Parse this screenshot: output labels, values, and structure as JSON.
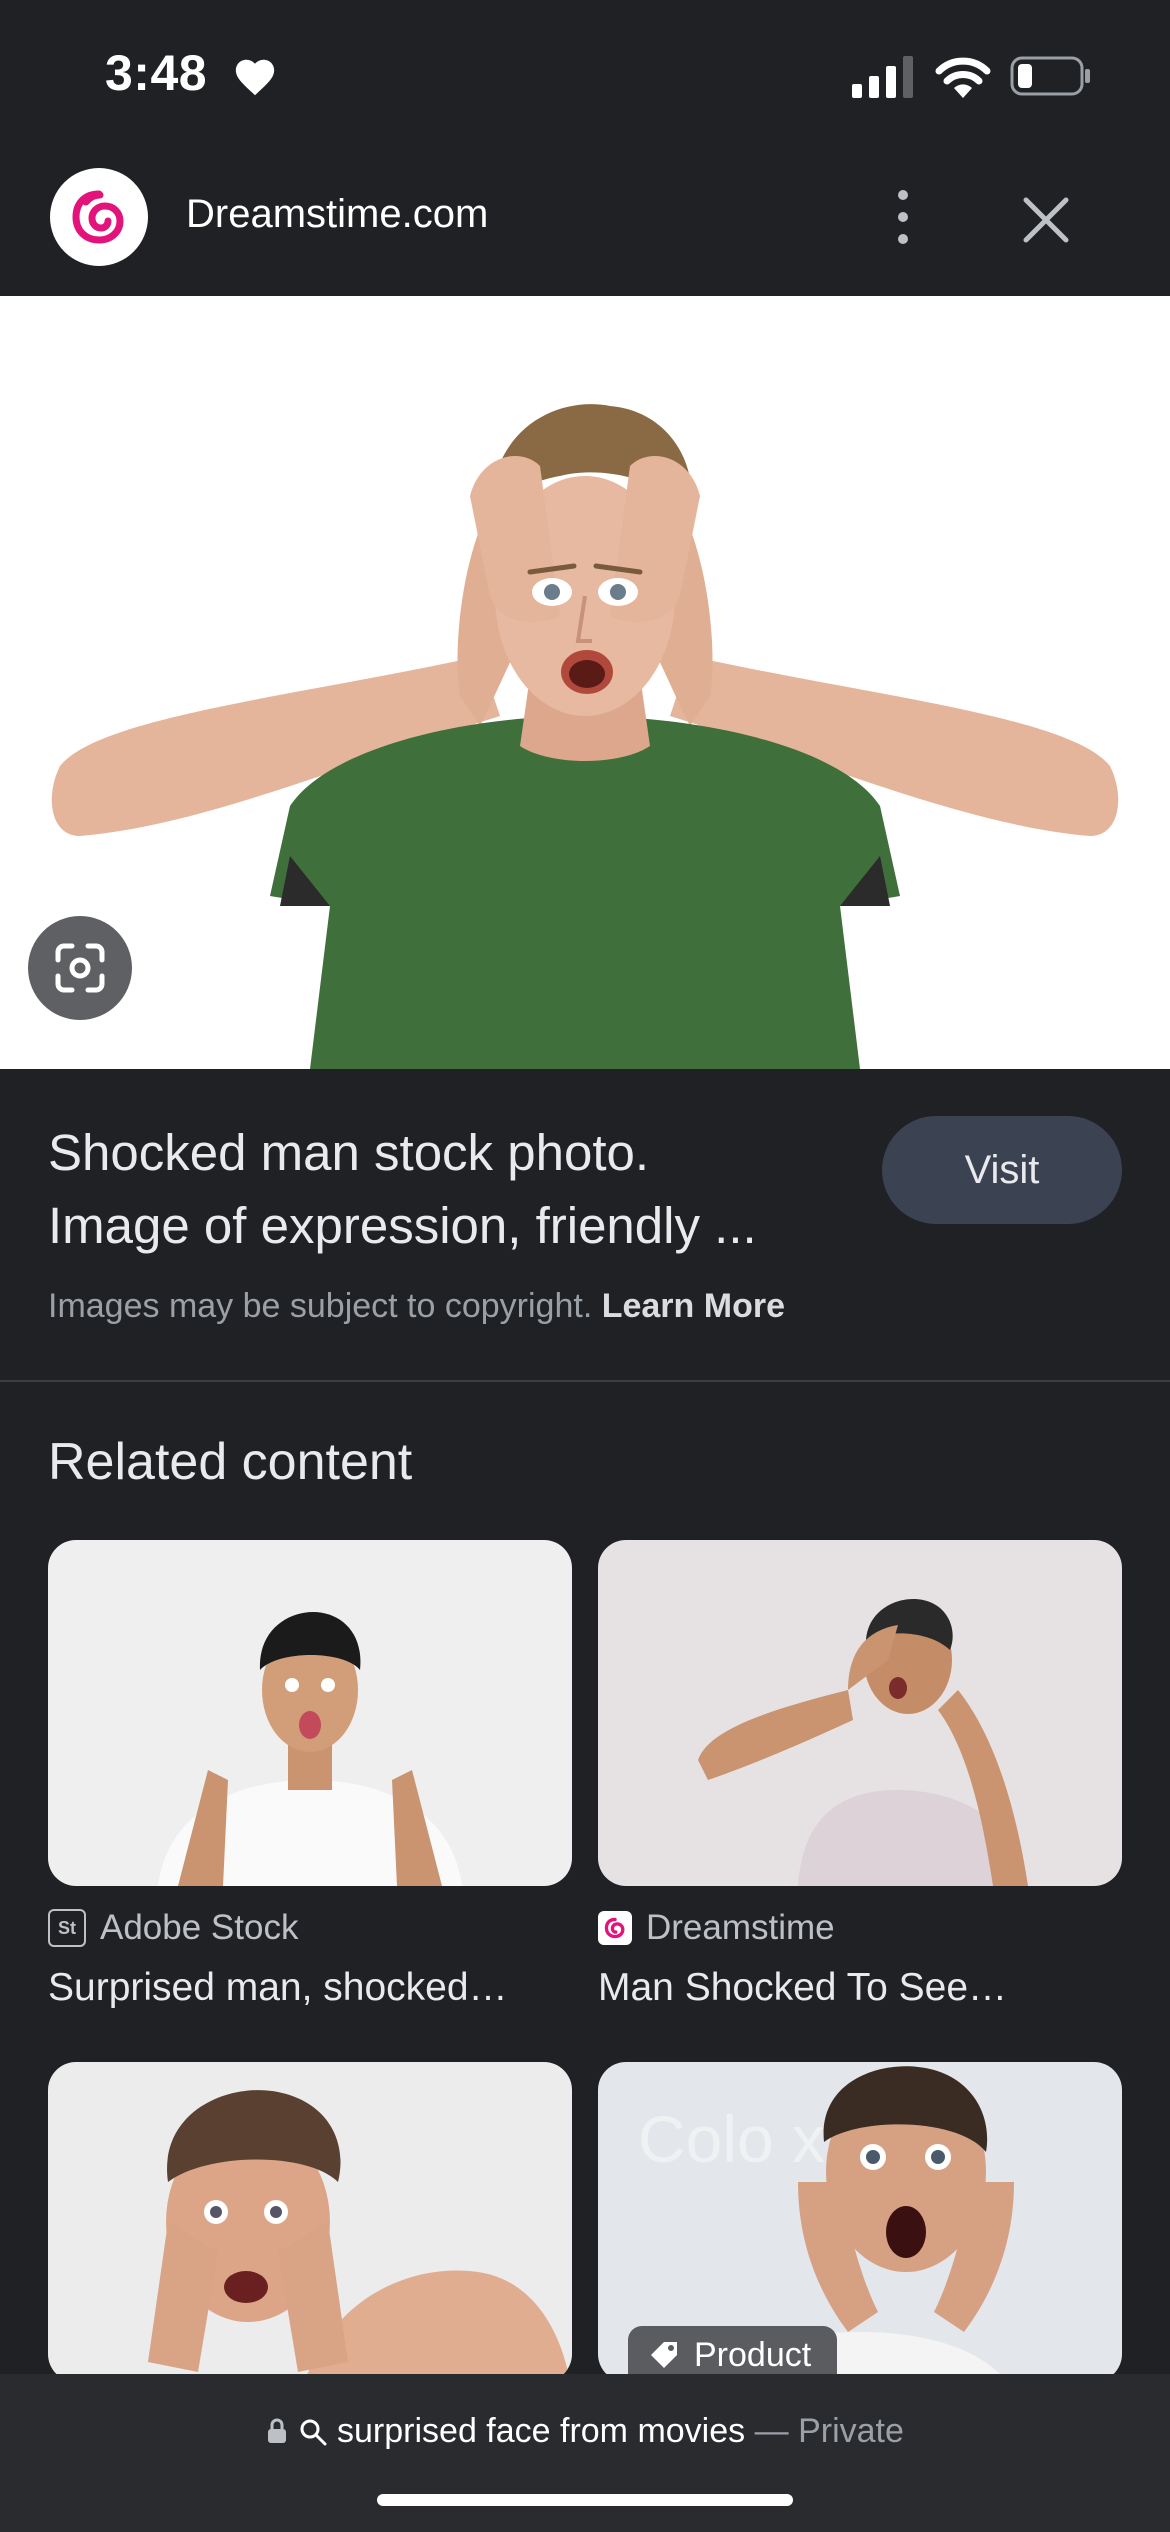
{
  "status_bar": {
    "time": "3:48"
  },
  "header": {
    "site_name": "Dreamstime.com"
  },
  "result": {
    "title_line1": "Shocked man stock photo.",
    "title_line2": "Image of expression, friendly ...",
    "visit_label": "Visit",
    "copyright_text": "Images may be subject to copyright.",
    "learn_more_label": "Learn More"
  },
  "related": {
    "heading": "Related content",
    "cards": [
      {
        "source": "Adobe Stock",
        "title": "Surprised man, shocked…",
        "source_icon": "adobe-stock-icon"
      },
      {
        "source": "Dreamstime",
        "title": "Man Shocked To See…",
        "source_icon": "dreamstime-icon"
      },
      {
        "source": "",
        "title": ""
      },
      {
        "source": "",
        "title": "",
        "badge": "Product"
      }
    ]
  },
  "bottom_bar": {
    "query": "surprised face from movies",
    "separator": "—",
    "mode": "Private"
  },
  "colors": {
    "background": "#202124",
    "visit_button": "#3b4252",
    "dreamstime_pink": "#e2137b"
  }
}
